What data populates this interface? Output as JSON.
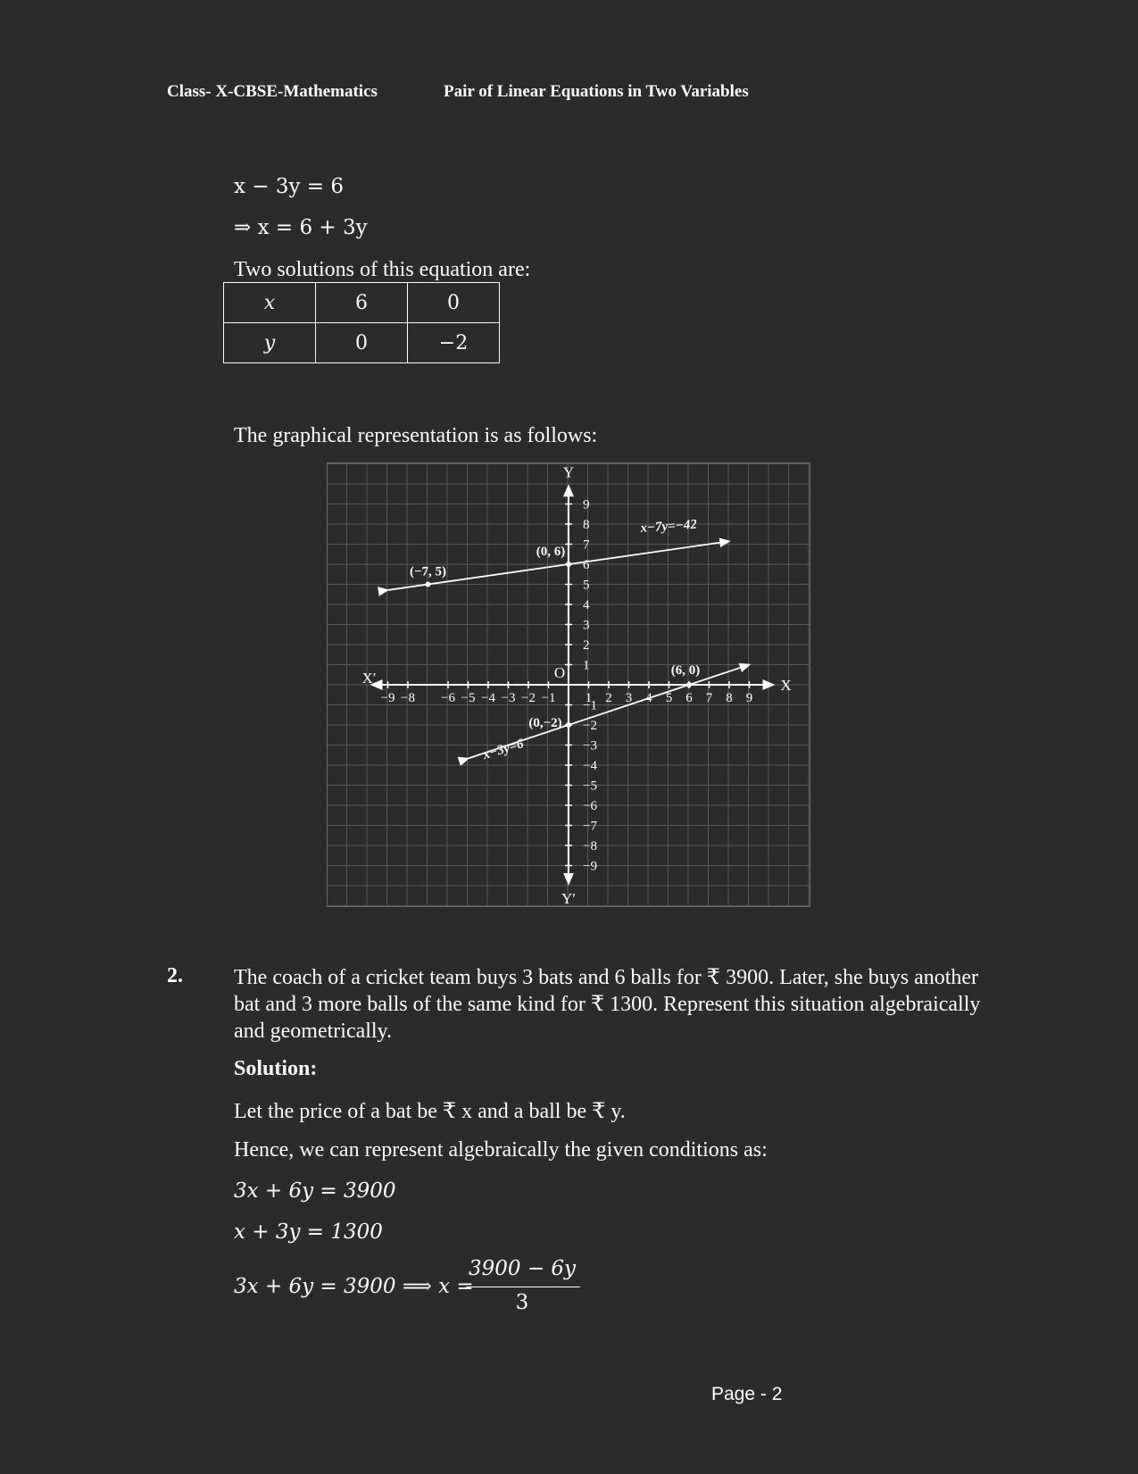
{
  "header": {
    "left": "Class- X-CBSE-Mathematics",
    "right": "Pair of Linear Equations in Two Variables"
  },
  "part1": {
    "eq1": "x − 3y = 6",
    "eq2": "⇒ x = 6 + 3y",
    "solutions_intro": "Two solutions of this equation are:",
    "table": {
      "rows": [
        {
          "label": "x",
          "values": [
            "6",
            "0"
          ]
        },
        {
          "label": "y",
          "values": [
            "0",
            "−2"
          ]
        }
      ]
    },
    "graph_intro": "The graphical representation is as follows:"
  },
  "chart_data": {
    "type": "line",
    "xlim": [
      -10,
      10
    ],
    "ylim": [
      -10,
      10
    ],
    "grid": true,
    "axis_labels": {
      "x_pos": "X",
      "x_neg": "X′",
      "y_pos": "Y",
      "y_neg": "Y′",
      "origin": "O"
    },
    "x_ticks": [
      "−9",
      "−8",
      "−6",
      "−5",
      "−4",
      "−3",
      "−2",
      "−1",
      "1",
      "2",
      "3",
      "4",
      "5",
      "6",
      "7",
      "8",
      "9"
    ],
    "x_tick_values": [
      -9,
      -8,
      -6,
      -5,
      -4,
      -3,
      -2,
      -1,
      1,
      2,
      3,
      4,
      5,
      6,
      7,
      8,
      9
    ],
    "y_ticks": [
      "9",
      "8",
      "7",
      "6",
      "5",
      "4",
      "3",
      "2",
      "1",
      "−1",
      "−2",
      "−3",
      "−4",
      "−5",
      "−6",
      "−7",
      "−8",
      "−9"
    ],
    "y_tick_values": [
      9,
      8,
      7,
      6,
      5,
      4,
      3,
      2,
      1,
      -1,
      -2,
      -3,
      -4,
      -5,
      -6,
      -7,
      -8,
      -9
    ],
    "series": [
      {
        "name": "x−7y=−42",
        "x": [
          -9,
          8
        ],
        "y": [
          4.714,
          7.143
        ],
        "points": [
          {
            "x": -7,
            "y": 5,
            "label": "(−7, 5)"
          },
          {
            "x": 0,
            "y": 6,
            "label": "(0, 6)"
          }
        ]
      },
      {
        "name": "x−3y=6",
        "x": [
          -5,
          9
        ],
        "y": [
          -3.667,
          1
        ],
        "points": [
          {
            "x": 6,
            "y": 0,
            "label": "(6, 0)"
          },
          {
            "x": 0,
            "y": -2,
            "label": "(0,−2)"
          }
        ]
      }
    ]
  },
  "question2": {
    "number": "2.",
    "text": "The coach of a cricket team buys 3 bats and 6 balls for ₹ 3900. Later, she buys another bat and 3 more balls of the same kind for ₹ 1300. Represent this situation algebraically and geometrically.",
    "solution_label": "Solution:",
    "let_line": "Let the price of a bat be ₹ x and a ball be ₹ y.",
    "hence_line": "Hence, we can represent algebraically the given conditions as:",
    "eq1": "3x + 6y = 3900",
    "eq2": "x + 3y = 1300",
    "derivation_lhs": "3x + 6y = 3900 ⟹ x =",
    "frac_num": "3900 − 6y",
    "frac_den": "3"
  },
  "footer": {
    "page": "Page - 2"
  }
}
